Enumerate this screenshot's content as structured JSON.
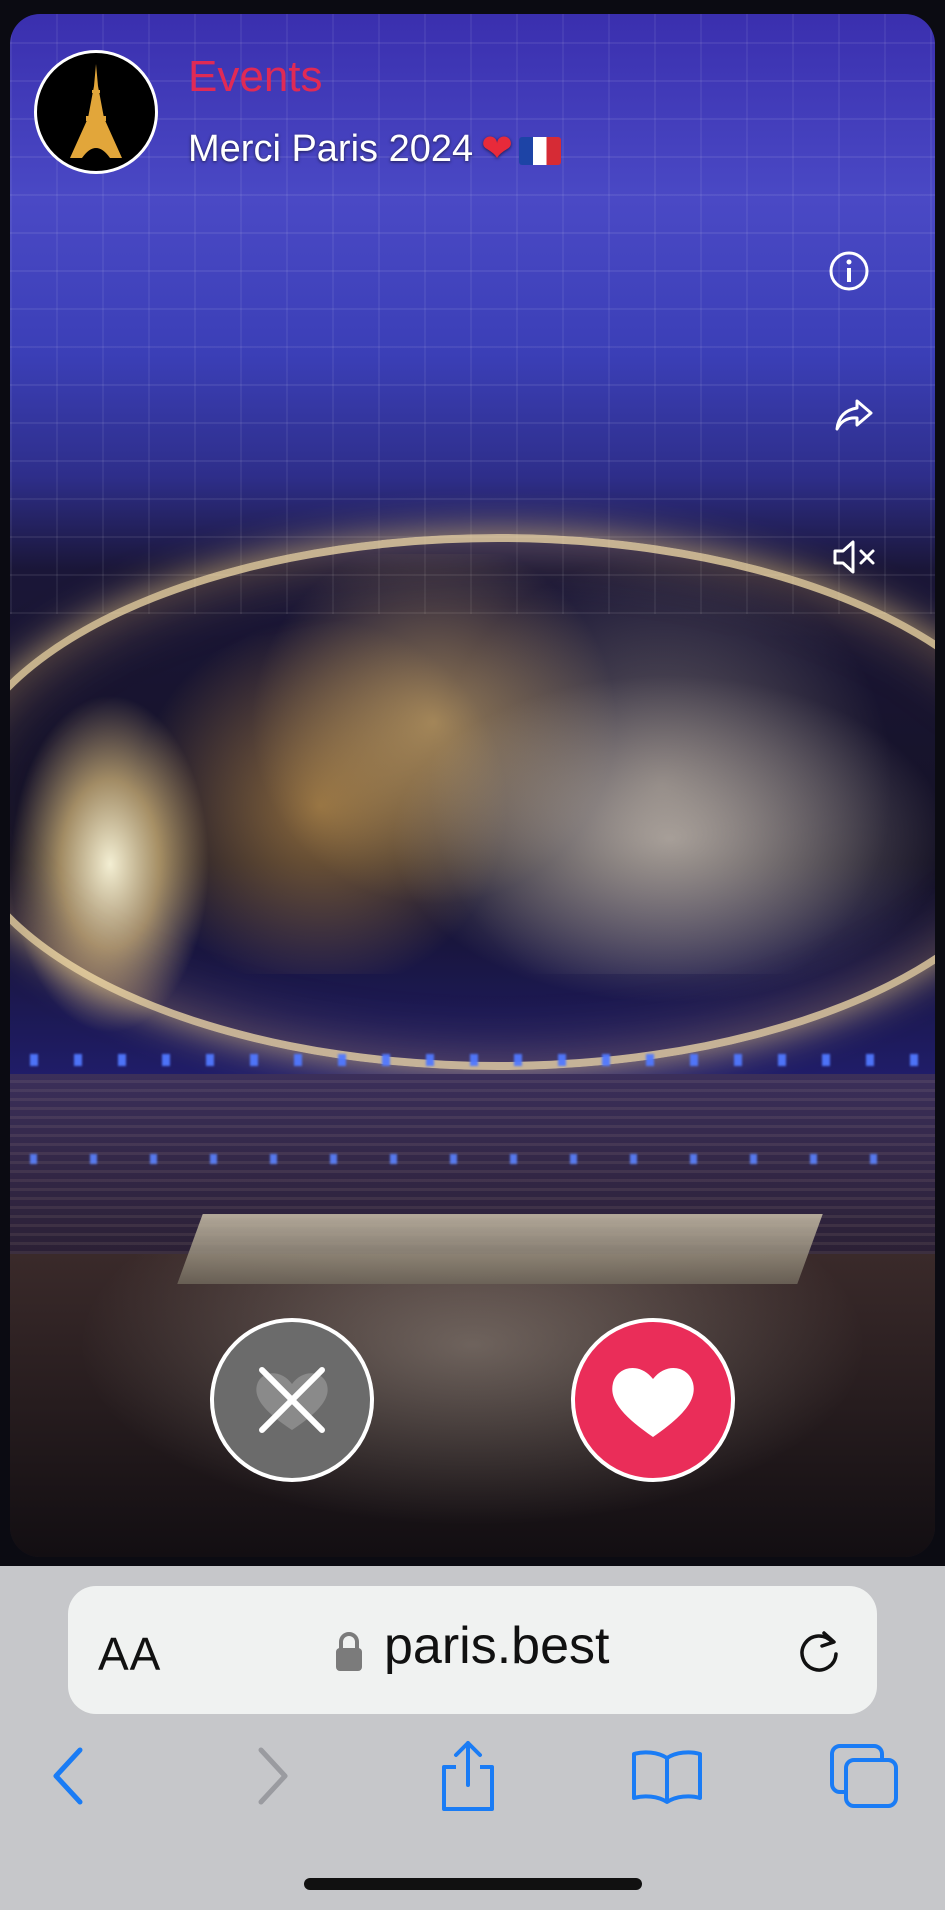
{
  "header": {
    "avatar_icon": "eiffel-tower-icon",
    "brand_label": "Events",
    "title": "Merci Paris 2024"
  },
  "side_actions": [
    {
      "name": "info-button",
      "icon": "info-icon"
    },
    {
      "name": "share-button",
      "icon": "share-arrow-icon"
    },
    {
      "name": "mute-button",
      "icon": "speaker-muted-icon"
    }
  ],
  "actions": {
    "dislike_icon": "close-x-icon",
    "like_icon": "heart-icon"
  },
  "browser": {
    "text_size_label": "AA",
    "url": "paris.best",
    "toolbar": [
      "back-icon",
      "forward-icon",
      "share-icon",
      "bookmarks-icon",
      "tabs-icon"
    ]
  },
  "colors": {
    "brand": "#e02a55",
    "like": "#ea2d59",
    "dislike": "#6b6b6b",
    "toolbar_active": "#1a7cf5",
    "toolbar_disabled": "#9a9ba0",
    "chrome_bg": "#c6c7ca"
  }
}
